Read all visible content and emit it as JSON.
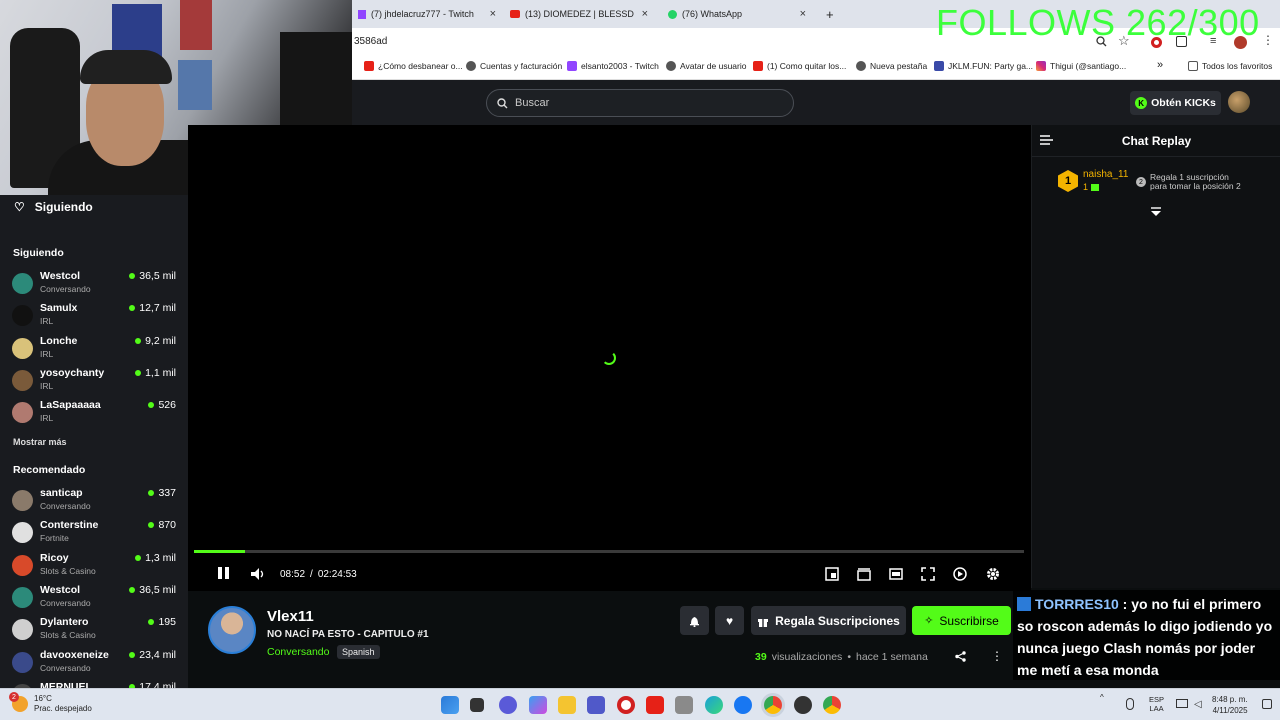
{
  "overlay": {
    "follows_goal": "FOLLOWS 262/300",
    "chat_message": {
      "user": "TORRRES10",
      "separator": ":",
      "text": "yo no fui el primero so roscon además lo digo jodiendo yo nunca juego Clash nomás por joder me metí a esa monda"
    }
  },
  "browser": {
    "tabs": [
      {
        "title": "(7) jhdelacruz777 - Twitch",
        "icon": "twitch-icon",
        "close": "×"
      },
      {
        "title": "(13) DIOMEDEZ | BLESSD",
        "icon": "youtube-icon",
        "close": "×"
      },
      {
        "title": "(76) WhatsApp",
        "icon": "whatsapp-icon",
        "close": "×"
      }
    ],
    "new_tab": "+",
    "address": "3586ad",
    "bookmarks": [
      {
        "label": "¿Cómo desbanear o...",
        "icon": "youtube-icon"
      },
      {
        "label": "Cuentas y facturación",
        "icon": "globe-icon"
      },
      {
        "label": "elsanto2003 - Twitch",
        "icon": "twitch-icon"
      },
      {
        "label": "Avatar de usuario",
        "icon": "globe-icon"
      },
      {
        "label": "(1) Como quitar los...",
        "icon": "youtube-icon"
      },
      {
        "label": "Nueva pestaña",
        "icon": "globe-icon"
      },
      {
        "label": "JKLM.FUN: Party ga...",
        "icon": "jklm-icon"
      },
      {
        "label": "Thigui (@santiago...",
        "icon": "instagram-icon"
      }
    ],
    "bookmarks_more": "»",
    "all_favorites": "Todos los favoritos"
  },
  "header": {
    "search_placeholder": "Buscar",
    "kicks_button": "Obtén KICKs"
  },
  "sidebar": {
    "following_title": "Siguiendo",
    "following_section": "Siguiendo",
    "following": [
      {
        "name": "Westcol",
        "category": "Conversando",
        "viewers": "36,5 mil",
        "color": "#2c8a7a"
      },
      {
        "name": "Samulx",
        "category": "IRL",
        "viewers": "12,7 mil",
        "color": "#111111"
      },
      {
        "name": "Lonche",
        "category": "IRL",
        "viewers": "9,2 mil",
        "color": "#d9c27a"
      },
      {
        "name": "yosoychanty",
        "category": "IRL",
        "viewers": "1,1 mil",
        "color": "#7a5a3a"
      },
      {
        "name": "LaSapaaaaa",
        "category": "IRL",
        "viewers": "526",
        "color": "#b07a70"
      }
    ],
    "show_more": "Mostrar más",
    "recommended_section": "Recomendado",
    "recommended": [
      {
        "name": "santicap",
        "category": "Conversando",
        "viewers": "337",
        "color": "#8a7a6a"
      },
      {
        "name": "Conterstine",
        "category": "Fortnite",
        "viewers": "870",
        "color": "#e0e0e0"
      },
      {
        "name": "Ricoy",
        "category": "Slots & Casino",
        "viewers": "1,3 mil",
        "color": "#d84a2a"
      },
      {
        "name": "Westcol",
        "category": "Conversando",
        "viewers": "36,5 mil",
        "color": "#2c8a7a"
      },
      {
        "name": "Dylantero",
        "category": "Slots & Casino",
        "viewers": "195",
        "color": "#cfcfcf"
      },
      {
        "name": "davooxeneize",
        "category": "Conversando",
        "viewers": "23,4 mil",
        "color": "#3a4a8a"
      },
      {
        "name": "MERNUEL",
        "category": "",
        "viewers": "17,4 mil",
        "color": "#444444"
      }
    ]
  },
  "player": {
    "current_time": "08:52",
    "separator": "/",
    "duration": "02:24:53",
    "progress_fraction": 0.061
  },
  "stream": {
    "channel_name": "Vlex11",
    "title": "NO NACÍ PA ESTO - CAPITULO #1",
    "category": "Conversando",
    "language": "Spanish",
    "gift_button": "Regala Suscripciones",
    "subscribe_button": "Suscribirse",
    "views_count": "39",
    "views_label": "visualizaciones",
    "bullet": "•",
    "age": "hace 1 semana"
  },
  "chat": {
    "title": "Chat Replay",
    "pinned_rank": "1",
    "pinned_user": "naisha_11",
    "pinned_count": "1",
    "pinned_rank_icon": "2",
    "pinned_text_line1": "Regala 1 suscripción",
    "pinned_text_line2": "para tomar la posición 2"
  },
  "taskbar": {
    "weather_badge": "2",
    "temperature": "16°C",
    "weather": "Prac. despejado",
    "tray_chevron": "^",
    "lang_line1": "ESP",
    "lang_line2": "LAA",
    "time": "8:48 p. m.",
    "date": "4/11/2025"
  },
  "colors": {
    "kick_green": "#53fc18",
    "follows_green": "#3cff3c",
    "gold": "#f4b400"
  }
}
